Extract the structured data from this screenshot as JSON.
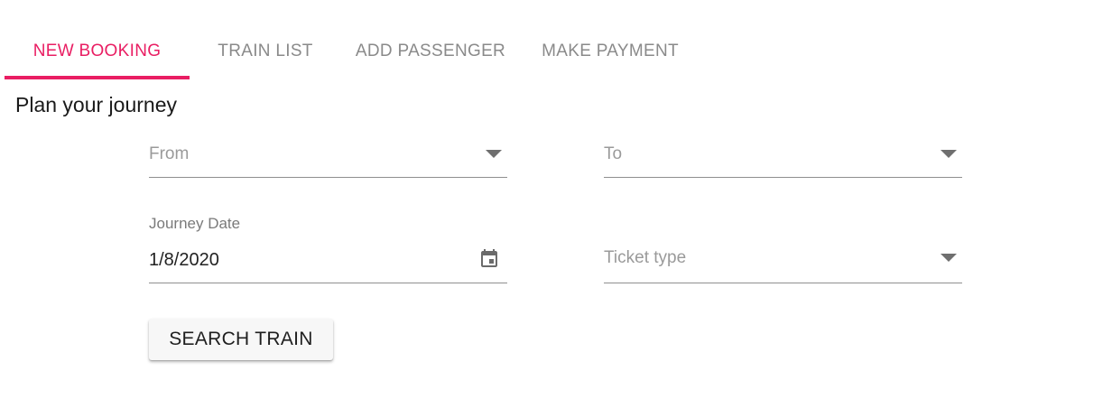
{
  "tabs": [
    {
      "label": "NEW BOOKING",
      "active": true
    },
    {
      "label": "TRAIN LIST",
      "active": false
    },
    {
      "label": "ADD PASSENGER",
      "active": false
    },
    {
      "label": "MAKE PAYMENT",
      "active": false
    }
  ],
  "form": {
    "title": "Plan your journey",
    "from": {
      "placeholder": "From",
      "icon": "chevron-down-icon"
    },
    "to": {
      "placeholder": "To",
      "icon": "chevron-down-icon"
    },
    "journey_date": {
      "label": "Journey Date",
      "value": "1/8/2020",
      "icon": "calendar-icon"
    },
    "ticket_type": {
      "placeholder": "Ticket type",
      "icon": "chevron-down-icon"
    },
    "search_button": "SEARCH TRAIN"
  },
  "colors": {
    "accent": "#e91e63",
    "inactive_tab": "#8a8a8a",
    "underline": "#8f8f8f"
  }
}
